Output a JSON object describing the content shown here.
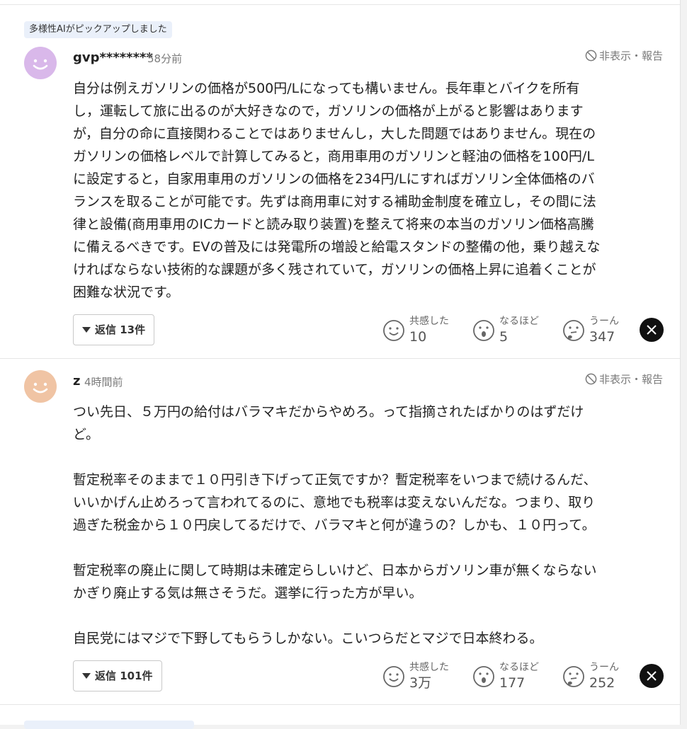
{
  "pickup_badge": "多様性AIがピックアップしました",
  "comments": [
    {
      "username": "gvp********",
      "time": "58分前",
      "report": "非表示・報告",
      "avatar_color": "#d9b8ea",
      "body": "自分は例えガソリンの価格が500円/Lになっても構いません。長年車とバイクを所有\nし，運転して旅に出るのが大好きなので，ガソリンの価格が上がると影響はあります\nが，自分の命に直接関わることではありませんし，大した問題ではありません。現在の\nガソリンの価格レベルで計算してみると，商用車用のガソリンと軽油の価格を100円/L\nに設定すると，自家用車用のガソリンの価格を234円/Lにすればガソリン全体価格のバ\nランスを取ることが可能です。先ずは商用車に対する補助金制度を確立し，その間に法\n律と設備(商用車用のICカードと読み取り装置)を整えて将来の本当のガソリン価格高騰\nに備えるべきです。EVの普及には発電所の増設と給電スタンドの整備の他，乗り越えな\nければならない技術的な課題が多く残されていて，ガソリンの価格上昇に追着くことが\n困難な状況です。",
      "reply": "返信 13件",
      "reactions": [
        {
          "label": "共感した",
          "count": "10"
        },
        {
          "label": "なるほど",
          "count": "5"
        },
        {
          "label": "うーん",
          "count": "347"
        }
      ]
    },
    {
      "username": "z",
      "time": "4時間前",
      "report": "非表示・報告",
      "avatar_color": "#f0c4a4",
      "body": "つい先日、５万円の給付はバラマキだからやめろ。って指摘されたばかりのはずだけ\nど。\n\n暫定税率そのままで１０円引き下げって正気ですか？暫定税率をいつまで続けるんだ、\nいいかげん止めろって言われてるのに、意地でも税率は変えないんだな。つまり、取り\n過ぎた税金から１０円戻してるだけで、バラマキと何が違うの？しかも、１０円って。\n\n暫定税率の廃止に関して時期は未確定らしいけど、日本からガソリン車が無くならない\nかぎり廃止する気は無さそうだ。選挙に行った方が早い。\n\n自民党にはマジで下野してもらうしかない。こいつらだとマジで日本終わる。",
      "reply": "返信 101件",
      "reactions": [
        {
          "label": "共感した",
          "count": "3万"
        },
        {
          "label": "なるほど",
          "count": "177"
        },
        {
          "label": "うーん",
          "count": "252"
        }
      ]
    }
  ]
}
